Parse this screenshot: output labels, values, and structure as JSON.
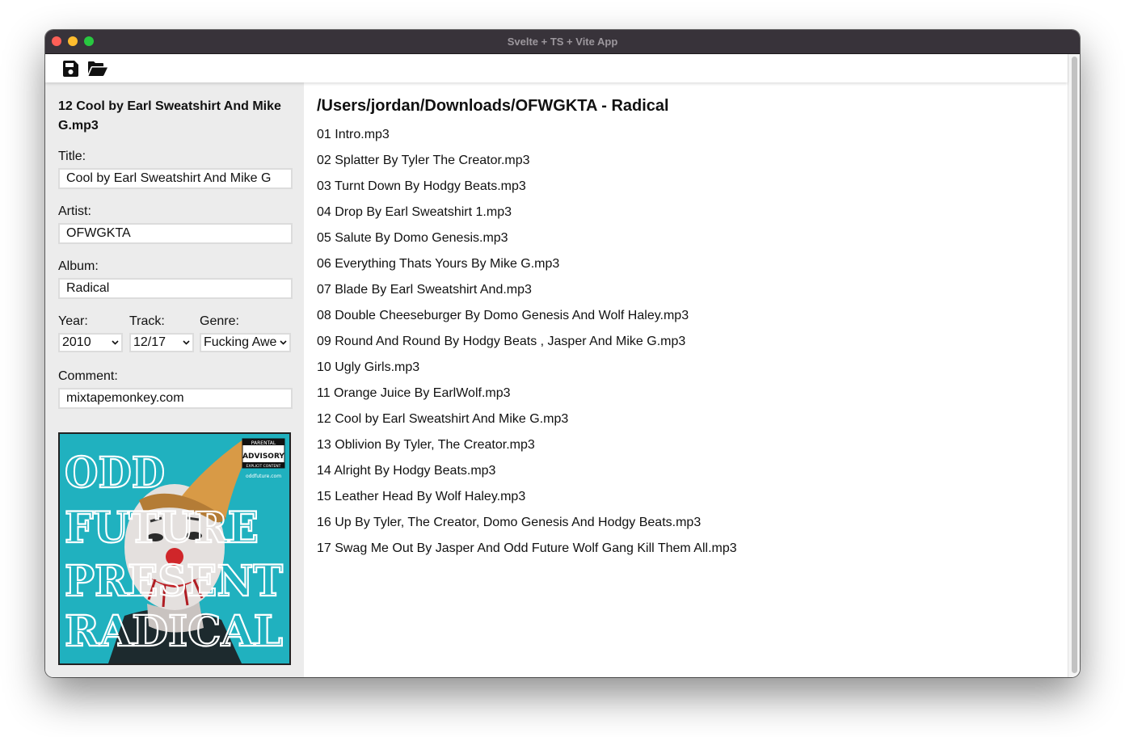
{
  "window": {
    "title": "Svelte + TS + Vite App"
  },
  "toolbar": {
    "save_icon": "floppy-disk-icon",
    "open_icon": "folder-open-icon"
  },
  "editor": {
    "file_name": "12 Cool by Earl Sweatshirt And Mike G.mp3",
    "title_label": "Title:",
    "title_value": "Cool by Earl Sweatshirt And Mike G",
    "artist_label": "Artist:",
    "artist_value": "OFWGKTA",
    "album_label": "Album:",
    "album_value": "Radical",
    "year_label": "Year:",
    "year_value": "2010",
    "track_label": "Track:",
    "track_value": "12/17",
    "genre_label": "Genre:",
    "genre_value": "Fucking Awesome",
    "comment_label": "Comment:",
    "comment_value": "mixtapemonkey.com"
  },
  "album_art": {
    "lines": [
      "ODD",
      "FUTURE",
      "PRESENT",
      "RADICAL"
    ],
    "advisory_top": "PARENTAL",
    "advisory_main": "ADVISORY",
    "advisory_bottom": "EXPLICIT CONTENT",
    "site": "oddfuture.com",
    "colors": {
      "background": "#23b5c4",
      "hat": "#d89a46"
    }
  },
  "browser": {
    "folder_path": "/Users/jordan/Downloads/OFWGKTA - Radical",
    "tracks": [
      "01 Intro.mp3",
      "02 Splatter By Tyler The Creator.mp3",
      "03 Turnt Down By Hodgy Beats.mp3",
      "04 Drop By Earl Sweatshirt 1.mp3",
      "05 Salute By Domo Genesis.mp3",
      "06 Everything Thats Yours By Mike G.mp3",
      "07 Blade By Earl Sweatshirt And.mp3",
      "08 Double Cheeseburger By Domo Genesis And Wolf Haley.mp3",
      "09 Round And Round By Hodgy Beats , Jasper And Mike G.mp3",
      "10 Ugly Girls.mp3",
      "11 Orange Juice By EarlWolf.mp3",
      "12 Cool by Earl Sweatshirt And Mike G.mp3",
      "13 Oblivion By Tyler, The Creator.mp3",
      "14 Alright By Hodgy Beats.mp3",
      "15 Leather Head By Wolf Haley.mp3",
      "16 Up By Tyler, The Creator, Domo Genesis And Hodgy Beats.mp3",
      "17 Swag Me Out By Jasper And Odd Future Wolf Gang Kill Them All.mp3"
    ]
  }
}
